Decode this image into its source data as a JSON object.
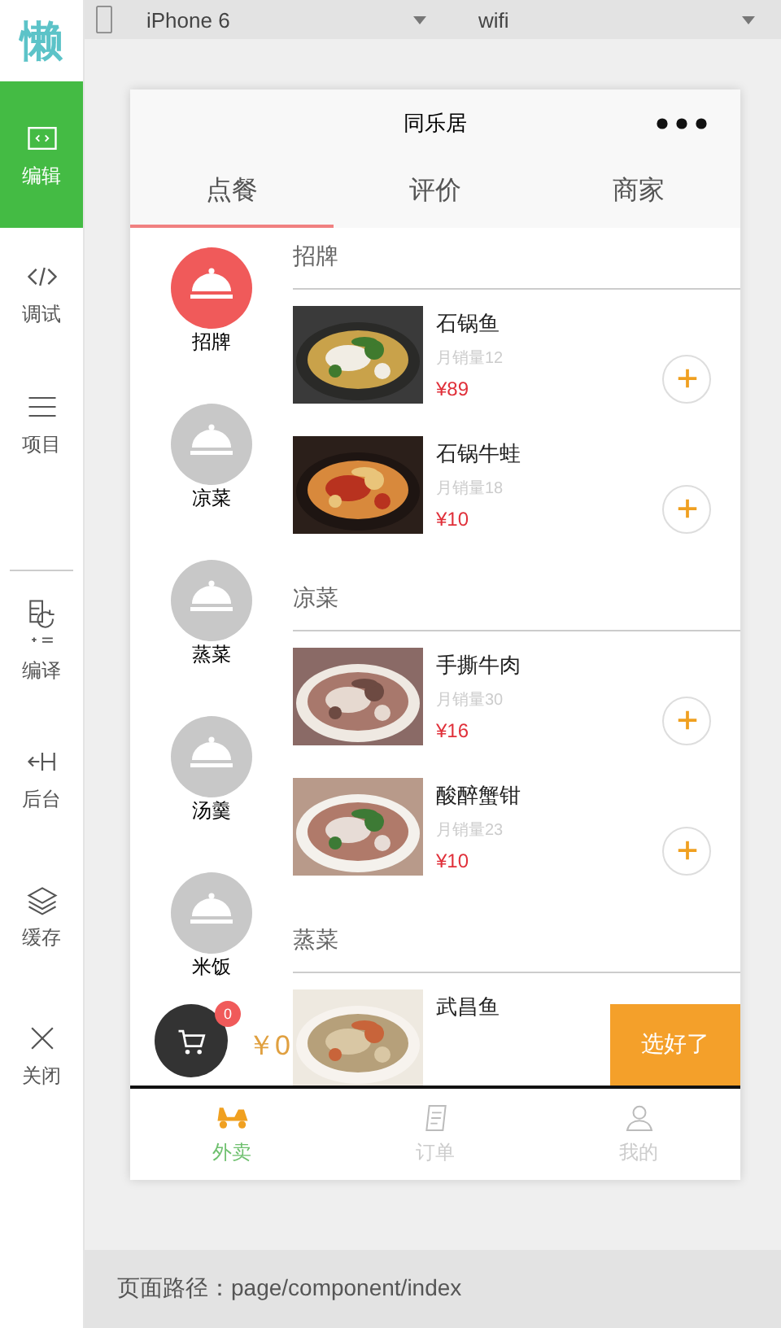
{
  "logo": "懒",
  "sidebar": {
    "top_items": [
      {
        "label": "编辑",
        "kind": "edit",
        "selected": true
      },
      {
        "label": "调试",
        "kind": "debug",
        "selected": false
      },
      {
        "label": "项目",
        "kind": "project",
        "selected": false
      }
    ],
    "bottom_items": [
      {
        "label": "编译",
        "kind": "compile",
        "selected": false
      },
      {
        "label": "后台",
        "kind": "backend",
        "selected": false
      },
      {
        "label": "缓存",
        "kind": "cache",
        "selected": false
      },
      {
        "label": "关闭",
        "kind": "close",
        "selected": false
      }
    ]
  },
  "toolbar": {
    "device": "iPhone 6",
    "network": "wifi"
  },
  "phone": {
    "title": "同乐居",
    "tabs": [
      {
        "label": "点餐",
        "selected": true
      },
      {
        "label": "评价",
        "selected": false
      },
      {
        "label": "商家",
        "selected": false
      }
    ],
    "categories": [
      {
        "label": "招牌",
        "selected": true
      },
      {
        "label": "凉菜",
        "selected": false
      },
      {
        "label": "蒸菜",
        "selected": false
      },
      {
        "label": "汤羹",
        "selected": false
      },
      {
        "label": "米饭",
        "selected": false
      }
    ],
    "sections": [
      {
        "title": "招牌",
        "dishes": [
          {
            "name": "石锅鱼",
            "sales": "月销量12",
            "price": "¥89"
          },
          {
            "name": "石锅牛蛙",
            "sales": "月销量18",
            "price": "¥10"
          }
        ]
      },
      {
        "title": "凉菜",
        "dishes": [
          {
            "name": "手撕牛肉",
            "sales": "月销量30",
            "price": "¥16"
          },
          {
            "name": "酸醉蟹钳",
            "sales": "月销量23",
            "price": "¥10"
          }
        ]
      },
      {
        "title": "蒸菜",
        "dishes": [
          {
            "name": "武昌鱼"
          }
        ]
      }
    ],
    "cart": {
      "count": "0",
      "total": "￥0",
      "checkout": "选好了"
    },
    "tabbar": [
      {
        "label": "外卖",
        "kind": "delivery",
        "selected": true
      },
      {
        "label": "订单",
        "kind": "orders",
        "selected": false
      },
      {
        "label": "我的",
        "kind": "profile",
        "selected": false
      }
    ]
  },
  "footer": {
    "path": "页面路径：page/component/index"
  }
}
